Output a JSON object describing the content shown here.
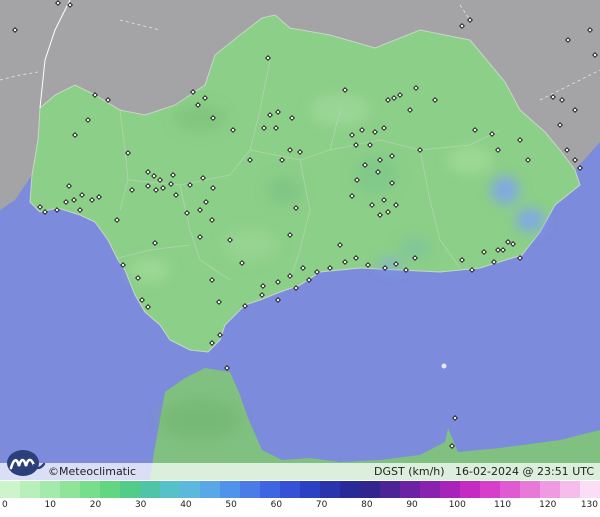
{
  "brand": {
    "copyright": "©",
    "name": "Meteoclimatic"
  },
  "map_info": {
    "variable": "DGST",
    "unit": "(km/h)",
    "date": "16-02-2024",
    "at": "@",
    "time": "23:51",
    "timezone": "UTC"
  },
  "icons": {
    "logo": "meteoclimatic-logo-icon",
    "station": "station-marker-icon"
  },
  "colors": {
    "sea": "#7d8bdc",
    "land_outside": "#a4a4a6",
    "andalusia_land": "#8ccf88",
    "morocco_land": "#80c080",
    "gust_highlight": "#7fa6e8"
  },
  "legend": {
    "ticks": [
      "0",
      "10",
      "20",
      "30",
      "40",
      "50",
      "60",
      "70",
      "80",
      "90",
      "100",
      "110",
      "120",
      "130"
    ],
    "colors": [
      "#ccf5cc",
      "#b8f0ba",
      "#a3ebaa",
      "#8ee59a",
      "#77de8c",
      "#63d681",
      "#53cc8a",
      "#4fc4a8",
      "#56c1c8",
      "#5cb8dd",
      "#5aa7e8",
      "#5093ea",
      "#4a7ce8",
      "#3f66e2",
      "#3552d6",
      "#2b41c4",
      "#2934ad",
      "#282a97",
      "#30268d",
      "#4d2496",
      "#6b22a3",
      "#8a22b0",
      "#a823b9",
      "#c42bc2",
      "#d63fc9",
      "#e05ad1",
      "#e879d9",
      "#f09ae2",
      "#f6bdec",
      "#fbddf6"
    ]
  }
}
